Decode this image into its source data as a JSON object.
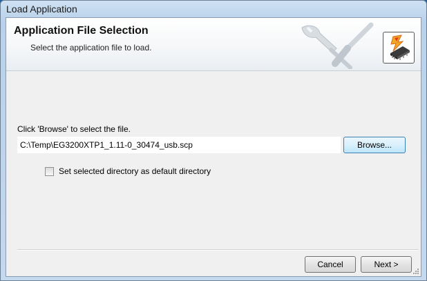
{
  "window": {
    "title": "Load Application"
  },
  "header": {
    "title": "Application File Selection",
    "subtitle": "Select the application file to load."
  },
  "content": {
    "prompt": "Click 'Browse' to select the file.",
    "file_path": "C:\\Temp\\EG3200XTP1_1.11-0_30474_usb.scp",
    "browse_label": "Browse...",
    "default_dir_label": "Set selected directory as default directory",
    "default_dir_checked": false
  },
  "footer": {
    "cancel_label": "Cancel",
    "next_label": "Next >"
  },
  "icons": {
    "header_art": "wrench-screwdriver-icon",
    "header_logo": "chip-lightning-icon"
  }
}
